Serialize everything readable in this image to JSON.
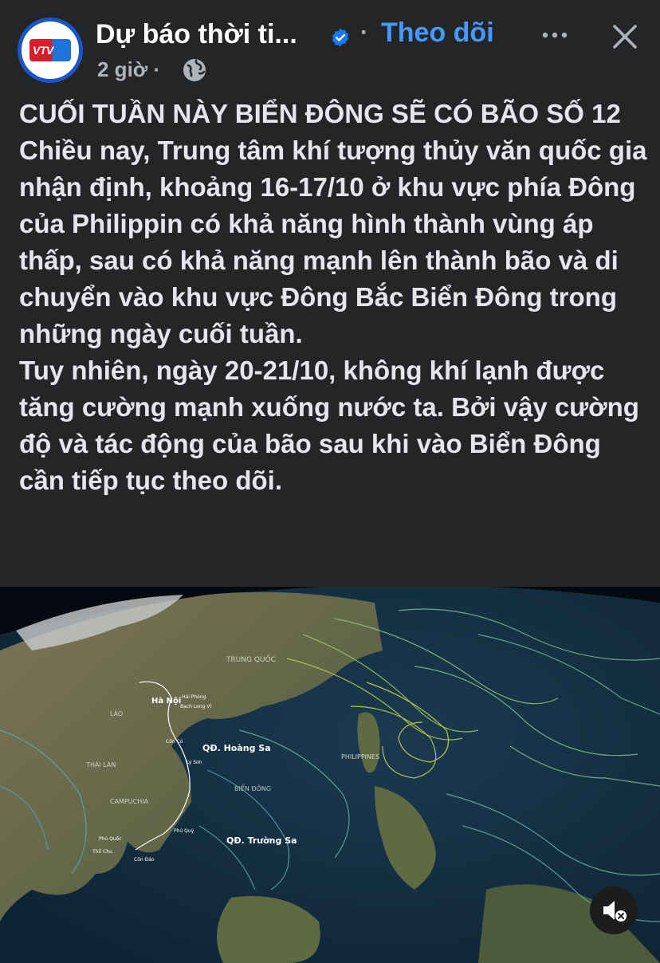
{
  "header": {
    "page_name": "Dự báo thời ti...",
    "follow_label": "Theo dõi",
    "separator": "·",
    "time": "2 giờ ·",
    "avatar_logo_text": "VTV"
  },
  "post": {
    "title": "CUỐI TUẦN NÀY BIỂN ĐÔNG SẼ CÓ BÃO SỐ 12",
    "paragraph1": "Chiều nay, Trung tâm khí tượng thủy văn quốc gia nhận định, khoảng 16-17/10 ở khu vực phía Đông của Philippin có khả năng hình thành vùng áp thấp, sau có khả năng mạnh lên thành bão và di chuyển vào khu vực Đông Bắc Biển Đông trong những ngày cuối tuần.",
    "paragraph2": "Tuy nhiên, ngày 20-21/10, không khí lạnh được tăng cường mạnh xuống nước ta. Bởi vậy cường độ và tác động của bão sau khi vào Biển Đông cần tiếp tục theo dõi."
  },
  "map": {
    "labels": {
      "china": "TRUNG QUỐC",
      "hanoi": "Hà Nội",
      "haiphong": "Hải Phòng",
      "bachlongvi": "Bạch Long Vĩ",
      "laos": "LÀO",
      "thailand": "THÁI LAN",
      "cambodia": "CAMPUCHIA",
      "hoangsa": "QĐ. Hoàng Sa",
      "truongsa": "QĐ. Trường Sa",
      "biendong": "BIỂN ĐÔNG",
      "philippines": "PHILIPPINES",
      "conco": "Cồn Cỏ",
      "lyson": "Lý Sơn",
      "phuquy": "Phú Quý",
      "phuquoc": "Phú Quốc",
      "thochu": "Thổ Chu",
      "condao": "Côn Đảo"
    }
  },
  "icons": {
    "verified": "verified-badge-icon",
    "more": "more-dots-icon",
    "close": "close-icon",
    "audience": "globe-icon",
    "mute": "speaker-muted-icon"
  },
  "colors": {
    "background": "#242526",
    "accent": "#4599ff",
    "text": "#e4e6eb",
    "secondary_text": "#b0b3b8"
  }
}
